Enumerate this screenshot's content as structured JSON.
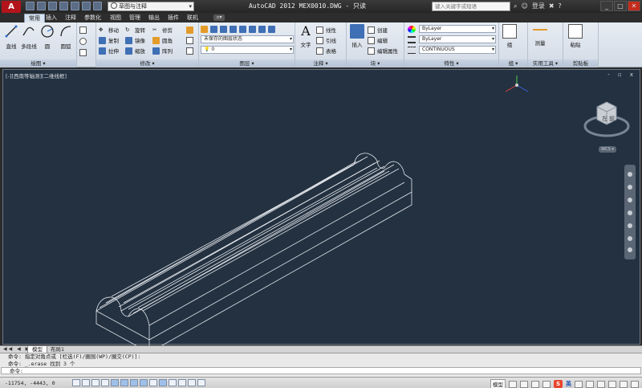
{
  "app": {
    "logo_label": "A",
    "title": "AutoCAD 2012    MEX0010.DWG - 只读"
  },
  "quick_access": {
    "workspace": "草图与注释"
  },
  "search": {
    "placeholder": "键入关键字或短语"
  },
  "login": {
    "label": "登录"
  },
  "window_buttons": [
    "_",
    "□",
    "✕"
  ],
  "ribbon_tabs": [
    "常用",
    "插入",
    "注释",
    "参数化",
    "视图",
    "管理",
    "输出",
    "插件",
    "联机"
  ],
  "ribbon_tab_toggle": "▫▾",
  "ribbon": {
    "draw": {
      "title": "绘图 ▾",
      "line": "直线",
      "polyline": "多段线",
      "circle": "圆",
      "arc": "圆弧"
    },
    "modify": {
      "title": "修改 ▾",
      "move": "移动",
      "rotate": "旋转",
      "trim": "修剪",
      "copy": "复制",
      "mirror": "镜像",
      "fillet": "圆角",
      "stretch": "拉伸",
      "scale": "缩放",
      "array": "阵列"
    },
    "layers": {
      "title": "图层 ▾",
      "state": "未保存的图层状态",
      "current": "0"
    },
    "annotation": {
      "title": "注释 ▾",
      "text": "文字",
      "linear": "线性",
      "leader": "引线",
      "table": "表格"
    },
    "block": {
      "title": "块 ▾",
      "insert": "插入",
      "create": "创建",
      "edit": "编辑",
      "edit_attr": "编辑属性"
    },
    "properties": {
      "title": "特性 ▾",
      "color": "ByLayer",
      "lineweight": "ByLayer",
      "linetype": "CONTINUOUS"
    },
    "groups": {
      "title": "组 ▾",
      "group": "组"
    },
    "utilities": {
      "title": "实用工具 ▾",
      "measure": "测量"
    },
    "clipboard": {
      "title": "剪贴板",
      "paste": "粘贴"
    }
  },
  "viewport": {
    "label": "[-][西南等轴测][二维线框]",
    "controls": "- ▫ x",
    "viewcube": {
      "left": "左",
      "front": "前",
      "wcs": "WCS ▾"
    }
  },
  "layout_tabs": {
    "arrows": "◀◀ ◀ ▶ ▶▶",
    "model": "模型",
    "layout1": "布局1"
  },
  "command_line": [
    "命令: 指定对角点或 [栏选(F)/圈围(WP)/圈交(CP)]:",
    "命令: _.erase 找到 3 个",
    "命令:"
  ],
  "status": {
    "coords": "-11754, -4443, 0",
    "model": "模型",
    "ime_s": "S",
    "ime_en": "英"
  }
}
